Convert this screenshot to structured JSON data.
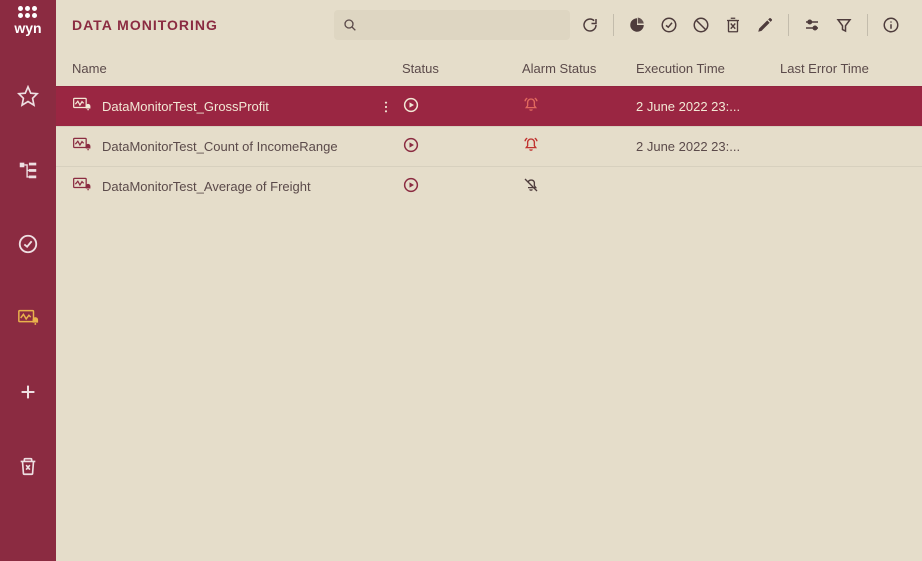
{
  "brand": "wyn",
  "title": "DATA MONITORING",
  "search": {
    "placeholder": ""
  },
  "columns": {
    "name": "Name",
    "status": "Status",
    "alarm": "Alarm Status",
    "exec": "Execution Time",
    "error": "Last Error Time"
  },
  "rows": [
    {
      "name": "DataMonitorTest_GrossProfit",
      "status": "play",
      "alarm": "ringing",
      "exec": "2 June 2022 23:...",
      "error": "",
      "selected": true
    },
    {
      "name": "DataMonitorTest_Count of IncomeRange",
      "status": "play",
      "alarm": "ringing",
      "exec": "2 June 2022 23:...",
      "error": "",
      "selected": false
    },
    {
      "name": "DataMonitorTest_Average of Freight",
      "status": "play",
      "alarm": "off",
      "exec": "",
      "error": "",
      "selected": false
    }
  ]
}
